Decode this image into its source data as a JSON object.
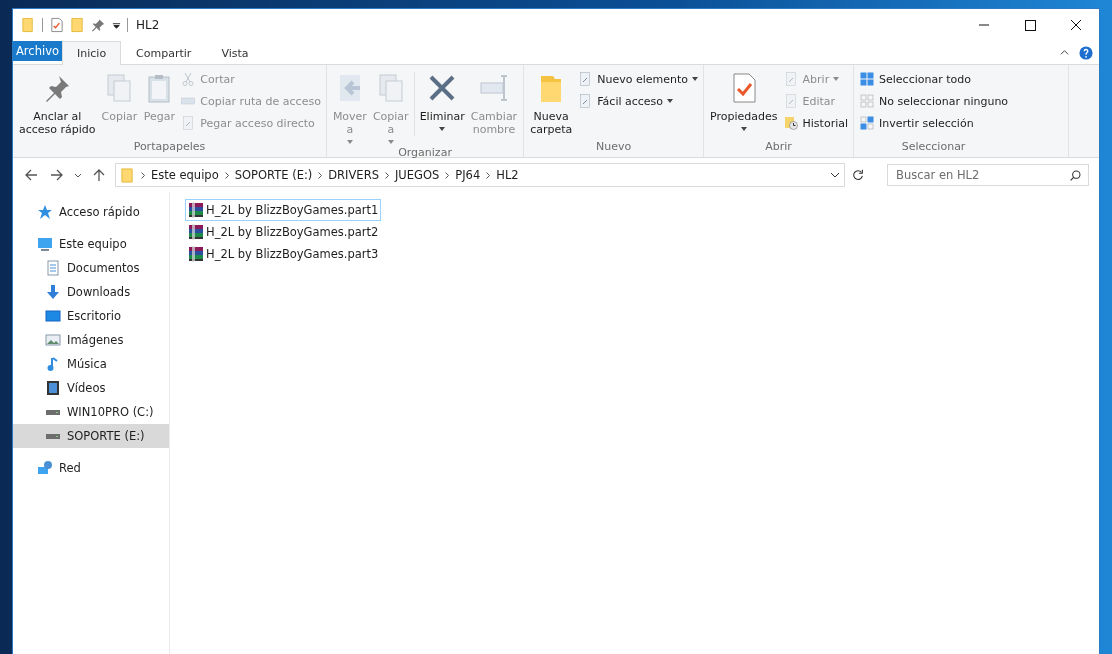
{
  "window": {
    "title": "HL2"
  },
  "tabs": [
    {
      "label": "Archivo",
      "kind": "file",
      "selected": false
    },
    {
      "label": "Inicio",
      "kind": "tab",
      "selected": true
    },
    {
      "label": "Compartir",
      "kind": "tab",
      "selected": false
    },
    {
      "label": "Vista",
      "kind": "tab",
      "selected": false
    }
  ],
  "ribbon": {
    "groups": [
      {
        "label": "Portapapeles",
        "items": [
          {
            "kind": "large",
            "label": "Anclar al\nacceso rápido",
            "disabled": false,
            "dropdown": false
          },
          {
            "kind": "large",
            "label": "Copiar",
            "disabled": true,
            "dropdown": false
          },
          {
            "kind": "large",
            "label": "Pegar",
            "disabled": true,
            "dropdown": false
          },
          {
            "kind": "stack",
            "items": [
              {
                "label": "Cortar",
                "disabled": true,
                "dropdown": false
              },
              {
                "label": "Copiar ruta de acceso",
                "disabled": true,
                "dropdown": false
              },
              {
                "label": "Pegar acceso directo",
                "disabled": true,
                "dropdown": false
              }
            ]
          }
        ]
      },
      {
        "label": "Organizar",
        "items": [
          {
            "kind": "large",
            "label": "Mover\na",
            "disabled": true,
            "dropdown": true
          },
          {
            "kind": "large",
            "label": "Copiar\na",
            "disabled": true,
            "dropdown": true
          },
          {
            "kind": "divider"
          },
          {
            "kind": "large",
            "label": "Eliminar",
            "disabled": false,
            "dropdown": true
          },
          {
            "kind": "large",
            "label": "Cambiar\nnombre",
            "disabled": true,
            "dropdown": false
          }
        ]
      },
      {
        "label": "Nuevo",
        "items": [
          {
            "kind": "large",
            "label": "Nueva\ncarpeta",
            "disabled": false,
            "dropdown": false
          },
          {
            "kind": "stack",
            "items": [
              {
                "label": "Nuevo elemento",
                "disabled": false,
                "dropdown": true
              },
              {
                "label": "Fácil acceso",
                "disabled": false,
                "dropdown": true
              }
            ]
          }
        ]
      },
      {
        "label": "Abrir",
        "items": [
          {
            "kind": "large",
            "label": "Propiedades",
            "disabled": false,
            "dropdown": true
          },
          {
            "kind": "stack",
            "items": [
              {
                "label": "Abrir",
                "disabled": true,
                "dropdown": true
              },
              {
                "label": "Editar",
                "disabled": true,
                "dropdown": false
              },
              {
                "label": "Historial",
                "disabled": false,
                "dropdown": false
              }
            ]
          }
        ]
      },
      {
        "label": "Seleccionar",
        "items": [
          {
            "kind": "stack",
            "items": [
              {
                "label": "Seleccionar todo",
                "disabled": false,
                "dropdown": false
              },
              {
                "label": "No seleccionar ninguno",
                "disabled": false,
                "dropdown": false
              },
              {
                "label": "Invertir selección",
                "disabled": false,
                "dropdown": false
              }
            ]
          }
        ]
      }
    ]
  },
  "address": {
    "path": [
      "Este equipo",
      "SOPORTE (E:)",
      "DRIVERS",
      "JUEGOS",
      "PJ64",
      "HL2"
    ]
  },
  "search": {
    "placeholder": "Buscar en HL2"
  },
  "sidebar": {
    "items": [
      {
        "label": "Acceso rápido",
        "selected": false
      },
      {
        "label": "Este equipo",
        "selected": false,
        "children": [
          {
            "label": "Documentos",
            "selected": false
          },
          {
            "label": "Downloads",
            "selected": false
          },
          {
            "label": "Escritorio",
            "selected": false
          },
          {
            "label": "Imágenes",
            "selected": false
          },
          {
            "label": "Música",
            "selected": false
          },
          {
            "label": "Vídeos",
            "selected": false
          },
          {
            "label": "WIN10PRO (C:)",
            "selected": false
          },
          {
            "label": "SOPORTE (E:)",
            "selected": true
          }
        ]
      },
      {
        "label": "Red",
        "selected": false
      }
    ]
  },
  "files": [
    {
      "name": "H_2L by BlizzBoyGames.part1",
      "focused": true
    },
    {
      "name": "H_2L by BlizzBoyGames.part2",
      "focused": false
    },
    {
      "name": "H_2L by BlizzBoyGames.part3",
      "focused": false
    }
  ]
}
